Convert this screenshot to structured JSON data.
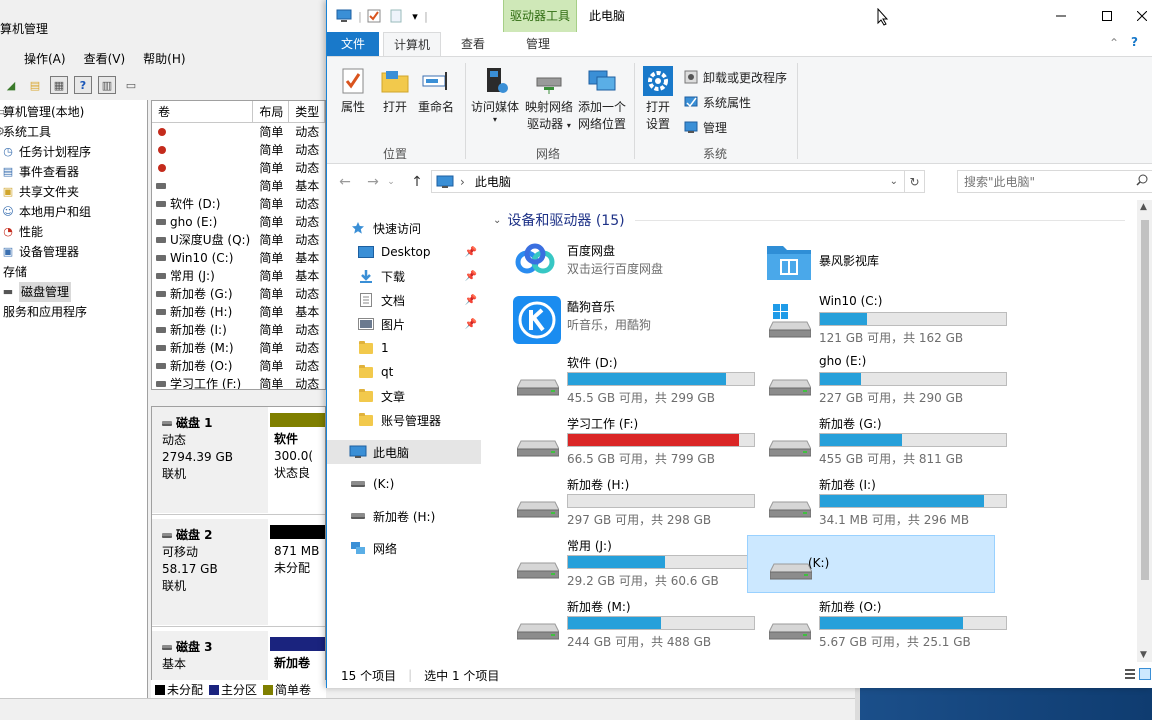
{
  "cm": {
    "title": "算机管理",
    "menu": [
      "操作(A)",
      "查看(V)",
      "帮助(H)"
    ],
    "menu_first": "",
    "tree": [
      {
        "label": "算机管理(本地)",
        "icon": "computer-icon",
        "indent": 0
      },
      {
        "label": "系统工具",
        "icon": "tools-icon",
        "indent": 0
      },
      {
        "label": "任务计划程序",
        "icon": "clock-icon",
        "indent": 1
      },
      {
        "label": "事件查看器",
        "icon": "event-icon",
        "indent": 1
      },
      {
        "label": "共享文件夹",
        "icon": "share-icon",
        "indent": 1
      },
      {
        "label": "本地用户和组",
        "icon": "users-icon",
        "indent": 1
      },
      {
        "label": "性能",
        "icon": "perf-icon",
        "indent": 1
      },
      {
        "label": "设备管理器",
        "icon": "device-icon",
        "indent": 1
      },
      {
        "label": "存储",
        "icon": "storage-icon",
        "indent": 0
      },
      {
        "label": "磁盘管理",
        "icon": "disk-icon",
        "indent": 1,
        "selected": true
      },
      {
        "label": "服务和应用程序",
        "icon": "services-icon",
        "indent": 0
      }
    ],
    "vol_headers": [
      "卷",
      "布局",
      "类型"
    ],
    "volumes": [
      {
        "name": "",
        "layout": "简单",
        "type": "动态",
        "err": true
      },
      {
        "name": "",
        "layout": "简单",
        "type": "动态",
        "err": true
      },
      {
        "name": "",
        "layout": "简单",
        "type": "动态",
        "err": true
      },
      {
        "name": "",
        "layout": "简单",
        "type": "基本",
        "err": false
      },
      {
        "name": "软件 (D:)",
        "layout": "简单",
        "type": "动态",
        "err": false
      },
      {
        "name": "gho (E:)",
        "layout": "简单",
        "type": "动态",
        "err": false
      },
      {
        "name": "U深度U盘 (Q:)",
        "layout": "简单",
        "type": "动态",
        "err": false
      },
      {
        "name": "Win10 (C:)",
        "layout": "简单",
        "type": "基本",
        "err": false
      },
      {
        "name": "常用 (J:)",
        "layout": "简单",
        "type": "基本",
        "err": false
      },
      {
        "name": "新加卷 (G:)",
        "layout": "简单",
        "type": "动态",
        "err": false
      },
      {
        "name": "新加卷 (H:)",
        "layout": "简单",
        "type": "基本",
        "err": false
      },
      {
        "name": "新加卷 (I:)",
        "layout": "简单",
        "type": "动态",
        "err": false
      },
      {
        "name": "新加卷 (M:)",
        "layout": "简单",
        "type": "动态",
        "err": false
      },
      {
        "name": "新加卷 (O:)",
        "layout": "简单",
        "type": "动态",
        "err": false
      },
      {
        "name": "学习工作 (F:)",
        "layout": "简单",
        "type": "动态",
        "err": false
      }
    ],
    "disks": [
      {
        "name": "磁盘 1",
        "line1": "动态",
        "line2": "2794.39 GB",
        "line3": "联机",
        "part_name": "软件",
        "part_size": "300.0(",
        "part_status": "状态良",
        "bar_color": "#7f7f00"
      },
      {
        "name": "磁盘 2",
        "line1": "可移动",
        "line2": "58.17 GB",
        "line3": "联机",
        "part_name": "",
        "part_size": "871 MB",
        "part_status": "未分配",
        "bar_color": "#000000"
      },
      {
        "name": "磁盘 3",
        "line1": "基本",
        "line2": "",
        "line3": "",
        "part_name": "新加卷",
        "part_size": "",
        "part_status": "",
        "bar_color": "#1a237e"
      }
    ],
    "legend": [
      {
        "label": "未分配",
        "color": "#000000"
      },
      {
        "label": "主分区",
        "color": "#1a237e"
      },
      {
        "label": "简单卷",
        "color": "#7f7f00"
      }
    ]
  },
  "fe": {
    "context_tab": "驱动器工具",
    "title": "此电脑",
    "tabs": {
      "file": "文件",
      "computer": "计算机",
      "view": "查看",
      "manage": "管理"
    },
    "ribbon": {
      "properties": "属性",
      "open": "打开",
      "rename": "重命名",
      "access_media": "访问媒体",
      "map_drive_1": "映射网络",
      "map_drive_2": "驱动器",
      "add_location_1": "添加一个",
      "add_location_2": "网络位置",
      "open_settings_1": "打开",
      "open_settings_2": "设置",
      "uninstall": "卸载或更改程序",
      "system_props": "系统属性",
      "manage": "管理",
      "group_location": "位置",
      "group_network": "网络",
      "group_system": "系统"
    },
    "address": "此电脑",
    "search_placeholder": "搜索\"此电脑\"",
    "nav": [
      {
        "label": "快速访问",
        "icon": "star-icon",
        "indent": 1,
        "pin": false
      },
      {
        "label": "Desktop",
        "icon": "desktop-icon",
        "indent": 2,
        "pin": true
      },
      {
        "label": "下载",
        "icon": "download-icon",
        "indent": 2,
        "pin": true
      },
      {
        "label": "文档",
        "icon": "document-icon",
        "indent": 2,
        "pin": true
      },
      {
        "label": "图片",
        "icon": "pictures-icon",
        "indent": 2,
        "pin": true
      },
      {
        "label": "1",
        "icon": "folder-icon",
        "indent": 2,
        "pin": false
      },
      {
        "label": "qt",
        "icon": "folder-icon",
        "indent": 2,
        "pin": false
      },
      {
        "label": "文章",
        "icon": "folder-icon",
        "indent": 2,
        "pin": false
      },
      {
        "label": "账号管理器",
        "icon": "folder-icon",
        "indent": 2,
        "pin": false
      },
      {
        "label": "此电脑",
        "icon": "this-pc-icon",
        "indent": 1,
        "pin": false,
        "selected": true
      },
      {
        "label": "(K:)",
        "icon": "drive-icon",
        "indent": 1,
        "pin": false
      },
      {
        "label": "新加卷 (H:)",
        "icon": "drive-icon",
        "indent": 1,
        "pin": false
      },
      {
        "label": "网络",
        "icon": "network-icon",
        "indent": 1,
        "pin": false
      }
    ],
    "group_header": "设备和驱动器 (15)",
    "apps": [
      {
        "name": "百度网盘",
        "sub": "双击运行百度网盘",
        "icon": "baidu-netdisk-icon"
      },
      {
        "name": "暴风影视库",
        "sub": "",
        "icon": "storm-video-icon"
      },
      {
        "name": "酷狗音乐",
        "sub": "听音乐，用酷狗",
        "icon": "kugou-icon"
      }
    ],
    "drives": [
      {
        "name": "Win10 (C:)",
        "free": "121 GB 可用，共 162 GB",
        "fill": 0.25,
        "red": false,
        "windows": true
      },
      {
        "name": "软件 (D:)",
        "free": "45.5 GB 可用，共 299 GB",
        "fill": 0.85,
        "red": false
      },
      {
        "name": "gho (E:)",
        "free": "227 GB 可用，共 290 GB",
        "fill": 0.22,
        "red": false
      },
      {
        "name": "学习工作 (F:)",
        "free": "66.5 GB 可用，共 799 GB",
        "fill": 0.92,
        "red": true
      },
      {
        "name": "新加卷 (G:)",
        "free": "455 GB 可用，共 811 GB",
        "fill": 0.44,
        "red": false
      },
      {
        "name": "新加卷 (H:)",
        "free": "297 GB 可用，共 298 GB",
        "fill": 0.0,
        "red": false
      },
      {
        "name": "新加卷 (I:)",
        "free": "34.1 MB 可用，共 296 MB",
        "fill": 0.88,
        "red": false
      },
      {
        "name": "常用 (J:)",
        "free": "29.2 GB 可用，共 60.6 GB",
        "fill": 0.52,
        "red": false
      },
      {
        "name": "(K:)",
        "free": "",
        "fill": null,
        "red": false,
        "selected": true
      },
      {
        "name": "新加卷 (M:)",
        "free": "244 GB 可用，共 488 GB",
        "fill": 0.5,
        "red": false
      },
      {
        "name": "新加卷 (O:)",
        "free": "5.67 GB 可用，共 25.1 GB",
        "fill": 0.77,
        "red": false
      }
    ],
    "status_items": "15 个项目",
    "status_selected": "选中 1 个项目"
  }
}
